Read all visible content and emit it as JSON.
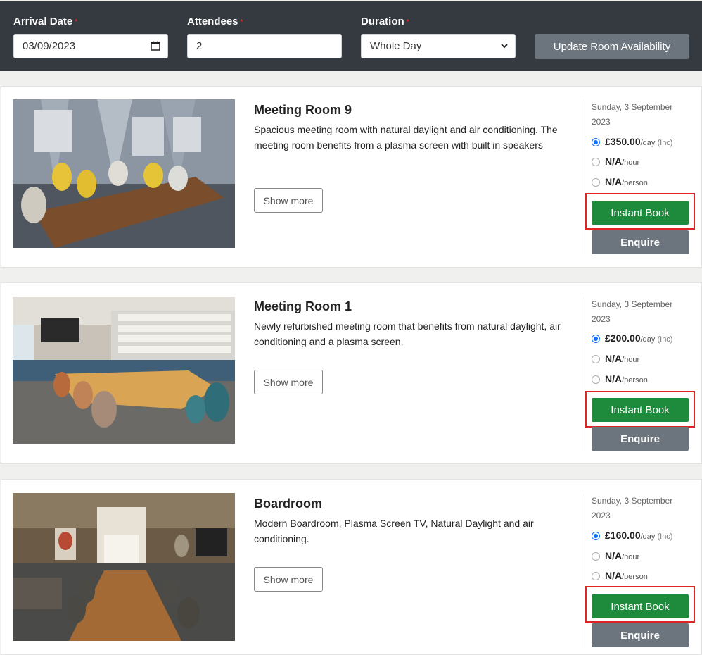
{
  "filters": {
    "arrival_label": "Arrival Date",
    "arrival_value": "03/09/2023",
    "attendees_label": "Attendees",
    "attendees_value": "2",
    "duration_label": "Duration",
    "duration_value": "Whole Day",
    "required_mark": "*",
    "update_label": "Update Room Availability"
  },
  "rooms": [
    {
      "name": "Meeting Room 9",
      "description": "Spacious meeting room with natural daylight and air conditioning. The meeting room benefits from a plasma screen with built in speakers",
      "show_more": "Show more",
      "date_line1": "Sunday, 3 September",
      "date_line2": "2023",
      "day_price": "£350.00",
      "day_unit": "/day",
      "day_note": "(Inc)",
      "hour_price": "N/A",
      "hour_unit": "/hour",
      "person_price": "N/A",
      "person_unit": "/person",
      "book_label": "Instant Book",
      "enquire_label": "Enquire"
    },
    {
      "name": "Meeting Room 1",
      "description": "Newly refurbished meeting room that benefits from natural daylight, air conditioning and a plasma screen.",
      "show_more": "Show more",
      "date_line1": "Sunday, 3 September",
      "date_line2": "2023",
      "day_price": "£200.00",
      "day_unit": "/day",
      "day_note": "(Inc)",
      "hour_price": "N/A",
      "hour_unit": "/hour",
      "person_price": "N/A",
      "person_unit": "/person",
      "book_label": "Instant Book",
      "enquire_label": "Enquire"
    },
    {
      "name": "Boardroom",
      "description": "Modern Boardroom, Plasma Screen TV, Natural Daylight and air conditioning.",
      "show_more": "Show more",
      "date_line1": "Sunday, 3 September",
      "date_line2": "2023",
      "day_price": "£160.00",
      "day_unit": "/day",
      "day_note": "(Inc)",
      "hour_price": "N/A",
      "hour_unit": "/hour",
      "person_price": "N/A",
      "person_unit": "/person",
      "book_label": "Instant Book",
      "enquire_label": "Enquire"
    }
  ]
}
